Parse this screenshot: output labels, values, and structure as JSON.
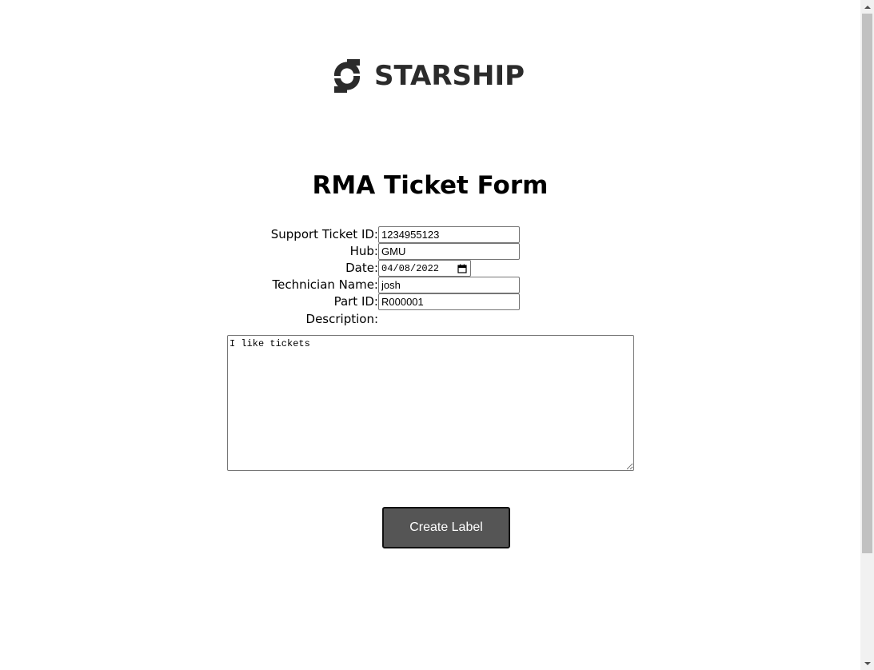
{
  "brand": {
    "name": "STARSHIP",
    "logo_icon": "starship-logo-icon"
  },
  "form": {
    "title": "RMA Ticket Form",
    "fields": {
      "support_ticket_id": {
        "label": "Support Ticket ID:",
        "value": "1234955123"
      },
      "hub": {
        "label": "Hub:",
        "value": "GMU"
      },
      "date": {
        "label": "Date:",
        "value": "04/08/2022",
        "icon": "calendar-icon"
      },
      "technician_name": {
        "label": "Technician Name:",
        "value": "josh"
      },
      "part_id": {
        "label": "Part ID:",
        "value": "R000001"
      },
      "description": {
        "label": "Description:",
        "value": "I like tickets"
      }
    },
    "submit_label": "Create Label"
  },
  "colors": {
    "button_bg": "#555555",
    "button_text": "#ffffff",
    "logo": "#2b2b2b"
  }
}
